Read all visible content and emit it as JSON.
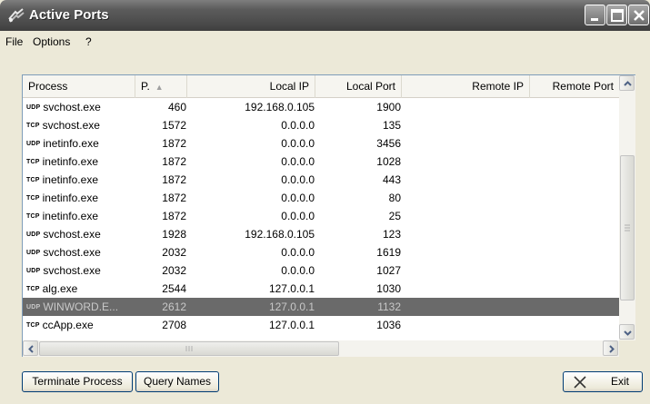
{
  "window": {
    "title": "Active Ports"
  },
  "menu": [
    "File",
    "Options",
    "?"
  ],
  "columns": {
    "process": "Process",
    "pid": "P.",
    "local_ip": "Local IP",
    "local_port": "Local Port",
    "remote_ip": "Remote IP",
    "remote_port": "Remote Port"
  },
  "rows": [
    {
      "proto": "UDP",
      "process": "svchost.exe",
      "pid": "460",
      "local_ip": "192.168.0.105",
      "local_port": "1900",
      "remote_ip": "",
      "remote_port": ""
    },
    {
      "proto": "TCP",
      "process": "svchost.exe",
      "pid": "1572",
      "local_ip": "0.0.0.0",
      "local_port": "135",
      "remote_ip": "",
      "remote_port": ""
    },
    {
      "proto": "UDP",
      "process": "inetinfo.exe",
      "pid": "1872",
      "local_ip": "0.0.0.0",
      "local_port": "3456",
      "remote_ip": "",
      "remote_port": ""
    },
    {
      "proto": "TCP",
      "process": "inetinfo.exe",
      "pid": "1872",
      "local_ip": "0.0.0.0",
      "local_port": "1028",
      "remote_ip": "",
      "remote_port": ""
    },
    {
      "proto": "TCP",
      "process": "inetinfo.exe",
      "pid": "1872",
      "local_ip": "0.0.0.0",
      "local_port": "443",
      "remote_ip": "",
      "remote_port": ""
    },
    {
      "proto": "TCP",
      "process": "inetinfo.exe",
      "pid": "1872",
      "local_ip": "0.0.0.0",
      "local_port": "80",
      "remote_ip": "",
      "remote_port": ""
    },
    {
      "proto": "TCP",
      "process": "inetinfo.exe",
      "pid": "1872",
      "local_ip": "0.0.0.0",
      "local_port": "25",
      "remote_ip": "",
      "remote_port": ""
    },
    {
      "proto": "UDP",
      "process": "svchost.exe",
      "pid": "1928",
      "local_ip": "192.168.0.105",
      "local_port": "123",
      "remote_ip": "",
      "remote_port": ""
    },
    {
      "proto": "UDP",
      "process": "svchost.exe",
      "pid": "2032",
      "local_ip": "0.0.0.0",
      "local_port": "1619",
      "remote_ip": "",
      "remote_port": ""
    },
    {
      "proto": "UDP",
      "process": "svchost.exe",
      "pid": "2032",
      "local_ip": "0.0.0.0",
      "local_port": "1027",
      "remote_ip": "",
      "remote_port": ""
    },
    {
      "proto": "TCP",
      "process": "alg.exe",
      "pid": "2544",
      "local_ip": "127.0.0.1",
      "local_port": "1030",
      "remote_ip": "",
      "remote_port": ""
    },
    {
      "proto": "UDP",
      "process": "WINWORD.E...",
      "pid": "2612",
      "local_ip": "127.0.0.1",
      "local_port": "1132",
      "remote_ip": "",
      "remote_port": "",
      "selected": true
    },
    {
      "proto": "TCP",
      "process": "ccApp.exe",
      "pid": "2708",
      "local_ip": "127.0.0.1",
      "local_port": "1036",
      "remote_ip": "",
      "remote_port": ""
    }
  ],
  "buttons": {
    "terminate": "Terminate Process",
    "query": "Query Names",
    "exit": "Exit"
  },
  "icons": {
    "app": "network-ports-icon",
    "minimize": "minimize-icon",
    "maximize": "maximize-icon",
    "close": "close-icon",
    "sort": "sort-ascending-icon",
    "exit": "x-icon"
  },
  "colors": {
    "titlebar": "#4d4d4d",
    "selected_row": "#6a6a6a",
    "selected_text": "#c8c8c8"
  }
}
